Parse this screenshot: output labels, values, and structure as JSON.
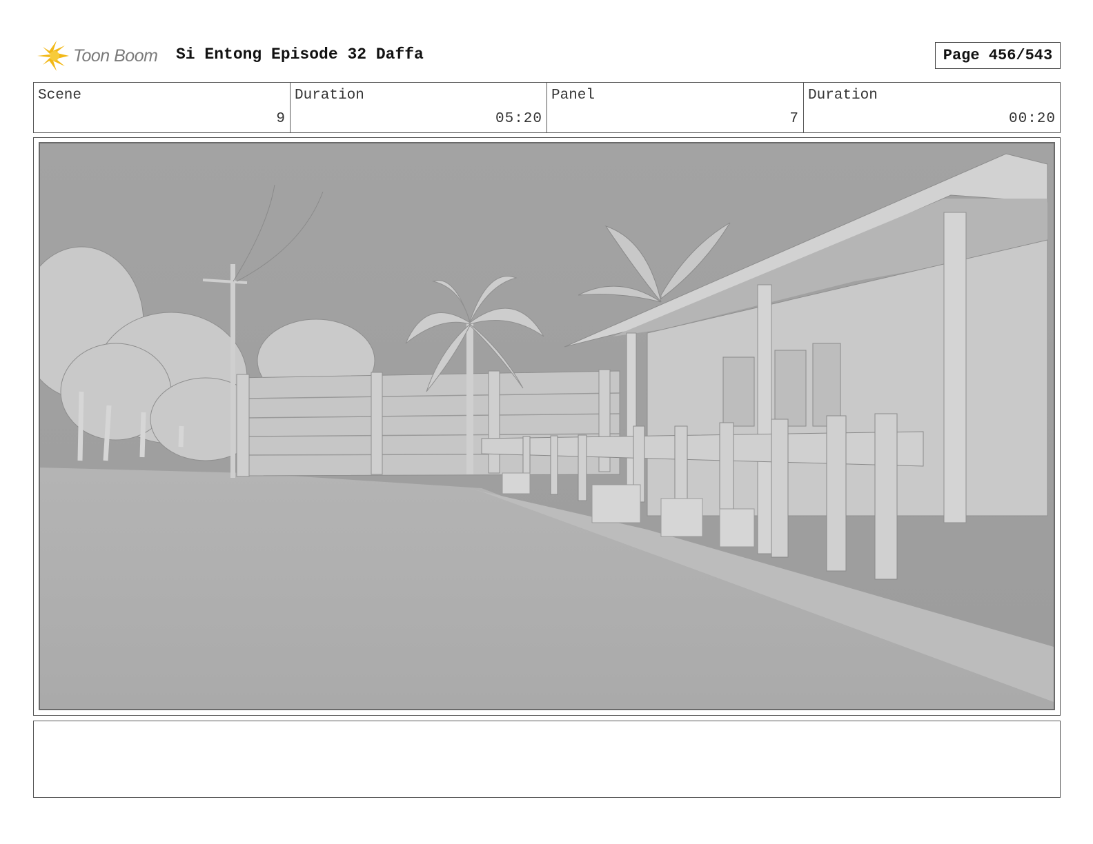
{
  "header": {
    "logo_text": "Toon Boom",
    "title": "Si Entong Episode 32 Daffa",
    "page": "Page 456/543"
  },
  "info": {
    "scene_label": "Scene",
    "scene_value": "9",
    "scene_duration_label": "Duration",
    "scene_duration_value": "05:20",
    "panel_label": "Panel",
    "panel_value": "7",
    "panel_duration_label": "Duration",
    "panel_duration_value": "00:20"
  },
  "notes": {
    "text": ""
  }
}
